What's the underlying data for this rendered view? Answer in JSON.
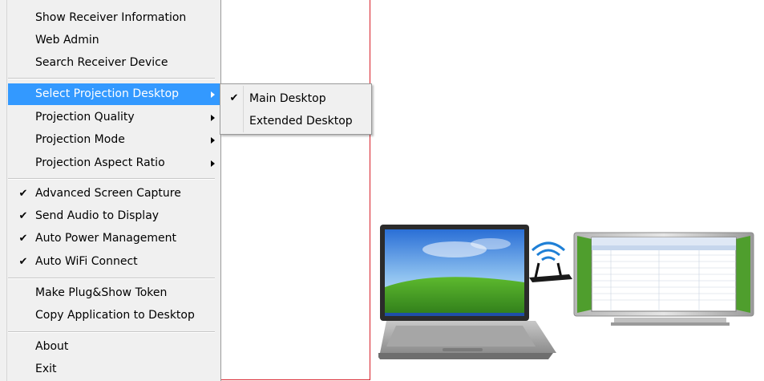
{
  "menu": {
    "items": [
      {
        "label": "Show Receiver Information"
      },
      {
        "label": "Web Admin"
      },
      {
        "label": "Search Receiver Device"
      },
      {
        "label": "Select Projection Desktop"
      },
      {
        "label": "Projection Quality"
      },
      {
        "label": "Projection Mode"
      },
      {
        "label": "Projection Aspect Ratio"
      },
      {
        "label": "Advanced Screen Capture",
        "checked": true
      },
      {
        "label": "Send Audio to Display",
        "checked": true
      },
      {
        "label": "Auto Power Management",
        "checked": true
      },
      {
        "label": "Auto WiFi Connect",
        "checked": true
      },
      {
        "label": "Make Plug&Show Token"
      },
      {
        "label": "Copy Application to Desktop"
      },
      {
        "label": "About"
      },
      {
        "label": "Exit"
      }
    ],
    "check_glyph": "✔"
  },
  "submenu": {
    "items": [
      {
        "label": "Main Desktop",
        "checked": true
      },
      {
        "label": "Extended Desktop",
        "checked": false
      }
    ]
  },
  "colors": {
    "highlight": "#3399ff",
    "frame": "#d8202a",
    "menu_bg": "#f0f0f0"
  },
  "icons": [
    "laptop-icon",
    "wifi-router-icon",
    "display-monitor-icon",
    "check-icon",
    "submenu-arrow-icon"
  ]
}
